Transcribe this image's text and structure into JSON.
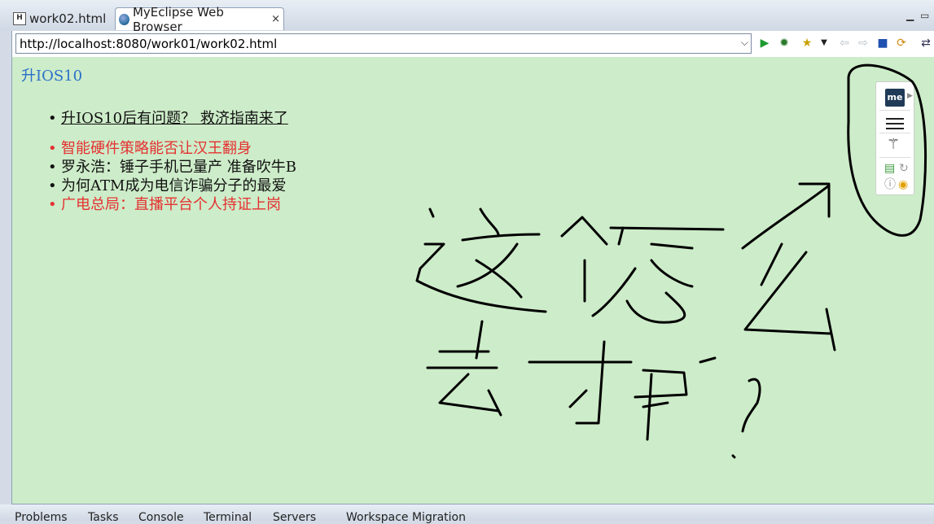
{
  "tabs": [
    {
      "label": "work02.html",
      "icon": "html-file-icon",
      "active": false
    },
    {
      "label": "MyEclipse Web Browser",
      "icon": "globe-icon",
      "active": true,
      "close": "×"
    }
  ],
  "window_controls": [
    "minimize-icon",
    "maximize-icon"
  ],
  "address_bar": {
    "url": "http://localhost:8080/work01/work02.html"
  },
  "toolbar_icons": [
    "go-icon",
    "debug-icon",
    "favorites-icon",
    "dropdown-icon",
    "back-icon",
    "forward-icon",
    "stop-icon",
    "refresh-icon",
    "sync-icon"
  ],
  "page": {
    "heading": "升IOS10",
    "news": [
      {
        "text": "升IOS10后有问题？ 救济指南来了",
        "color": "#111111",
        "link": true
      },
      {
        "text": "智能硬件策略能否让汉王翻身",
        "color": "#e53030"
      },
      {
        "text": "罗永浩：锤子手机已量产 准备吹牛B",
        "color": "#111111"
      },
      {
        "text": "为何ATM成为电信诈骗分子的最爱",
        "color": "#111111"
      },
      {
        "text": "广电总局：直播平台个人持证上岗",
        "color": "#e53030"
      }
    ]
  },
  "extension_panel": {
    "logo_text": "me",
    "icons": [
      "menu-icon",
      "magic-wand-icon",
      "cast-icon",
      "reload-icon",
      "info-icon",
      "eye-icon"
    ]
  },
  "bottom_tabs": [
    "Problems",
    "Tasks",
    "Console",
    "Terminal",
    "Servers",
    "Workspace Migration"
  ],
  "colors": {
    "content_bg": "#cdecc9",
    "heading": "#2a6fc9",
    "red": "#e53030"
  }
}
